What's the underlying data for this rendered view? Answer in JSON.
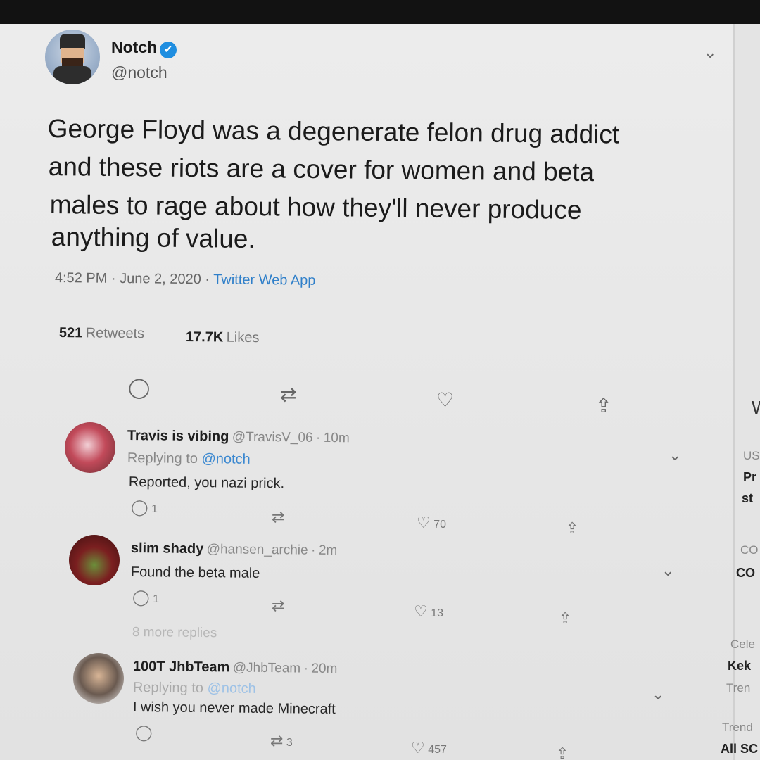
{
  "tweet": {
    "author_name": "Notch",
    "author_handle": "@notch",
    "verified_mark": "✔",
    "text_lines": [
      "George Floyd was a degenerate felon drug addict",
      "and these riots are a cover for women and beta",
      "males to rage about how they'll never produce",
      "anything of value."
    ],
    "time": "4:52 PM",
    "date": "June 2, 2020",
    "separator": "·",
    "source": "Twitter Web App",
    "retweets_count": "521",
    "retweets_label": "Retweets",
    "likes_count": "17.7K",
    "likes_label": "Likes"
  },
  "icons": {
    "caret": "⌄",
    "reply": "◯",
    "retweet": "⇄",
    "like": "♡",
    "share": "⇪"
  },
  "replies": [
    {
      "name": "Travis is vibing",
      "handle": "@TravisV_06",
      "separator": "·",
      "time": "10m",
      "replying_prefix": "Replying to",
      "replying_handle": "@notch",
      "text": "Reported, you nazi prick.",
      "reply_count": "1",
      "like_count": "70"
    },
    {
      "name": "slim shady",
      "handle": "@hansen_archie",
      "separator": "·",
      "time": "2m",
      "text": "Found the beta male",
      "reply_count": "1",
      "like_count": "13"
    },
    {
      "name": "100T JhbTeam",
      "handle": "@JhbTeam",
      "separator": "·",
      "time": "20m",
      "replying_prefix": "Replying to",
      "replying_handle": "@notch",
      "text": "I wish you never made Minecraft",
      "retweet_count": "3",
      "like_count": "457"
    }
  ],
  "more_replies": "8 more replies",
  "right_panel_fragments": [
    "W",
    "US",
    "Pr",
    "st",
    "CO",
    "CO",
    "Cele",
    "Kek",
    "Tren",
    "Trend",
    "All SC"
  ]
}
